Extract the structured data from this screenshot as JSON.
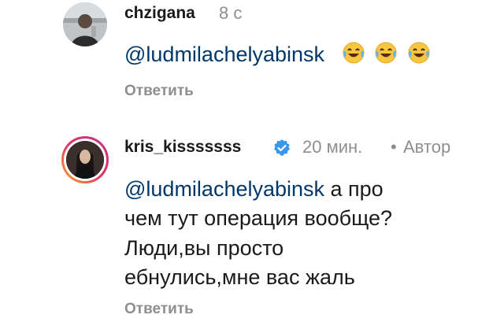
{
  "comments": [
    {
      "username": "chzigana",
      "time": "8 с",
      "mention": "@ludmilachelyabinsk",
      "emoji_count": 3,
      "emoji_names": [
        "joy-emoji",
        "joy-emoji",
        "joy-emoji"
      ],
      "reply_label": "Ответить"
    },
    {
      "username": "kris_kisssssss",
      "verified": true,
      "time": "20 мин.",
      "separator": "•",
      "author_label": "Автор",
      "mention": "@ludmilachelyabinsk",
      "text_line1": " а про",
      "text_line2": "чем тут операция вообще?",
      "text_line3": "Люди,вы просто",
      "text_line4": "ебнулись,мне вас жаль",
      "reply_label": "Ответить"
    }
  ],
  "colors": {
    "mention": "#00376b",
    "muted": "#8e8e8e",
    "text": "#1a1a1a",
    "verified": "#3897f0",
    "story_ring_start": "#f9a825",
    "story_ring_end": "#d81b60"
  }
}
